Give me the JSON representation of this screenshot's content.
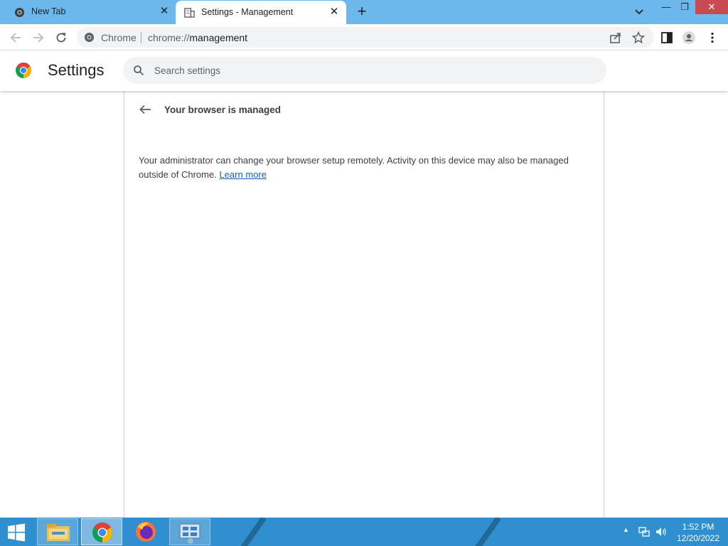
{
  "tabs": [
    {
      "title": "New Tab",
      "favicon": "chrome-icon",
      "active": false
    },
    {
      "title": "Settings - Management",
      "favicon": "building-icon",
      "active": true
    }
  ],
  "window_controls": {
    "minimize": "—",
    "restore": "❐",
    "close": "✕"
  },
  "toolbar": {
    "omnibox_chip": "Chrome",
    "url_scheme": "chrome://",
    "url_path": "management"
  },
  "settings": {
    "title": "Settings",
    "search_placeholder": "Search settings"
  },
  "management": {
    "heading": "Your browser is managed",
    "description": "Your administrator can change your browser setup remotely. Activity on this device may also be managed outside of Chrome.",
    "learn_more": "Learn more"
  },
  "taskbar": {
    "items": [
      "file-explorer",
      "chrome",
      "firefox",
      "control-panel"
    ],
    "time": "1:52 PM",
    "date": "12/20/2022"
  },
  "colors": {
    "tabstrip": "#6cb8ec",
    "taskbar": "#2f8fcf",
    "close_button": "#c74b50",
    "link": "#1a5fb4"
  }
}
